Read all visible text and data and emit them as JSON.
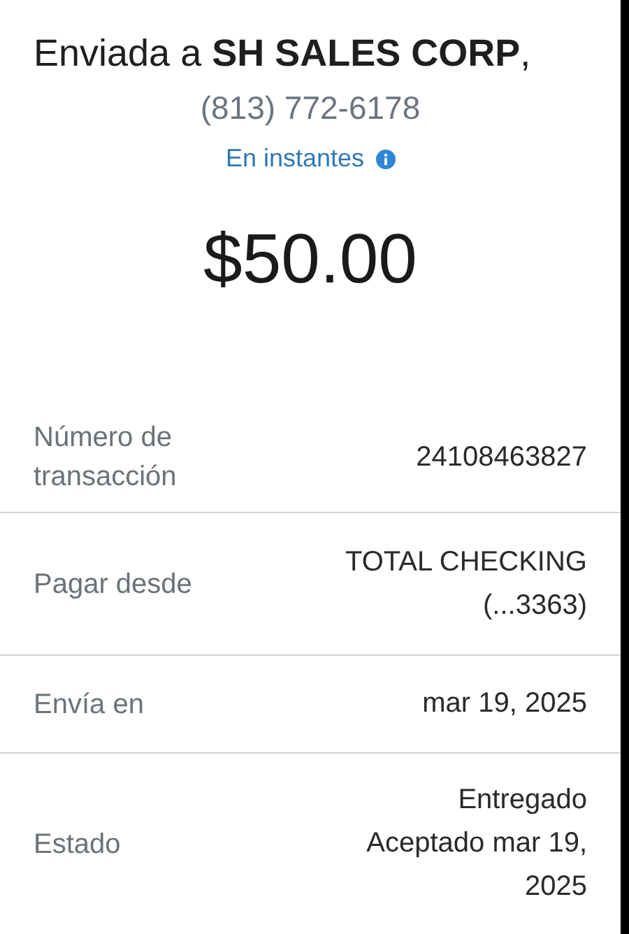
{
  "header": {
    "title": "Enviada a **SH SALES CORP**,",
    "phone": "(813) 772-6178",
    "speed": "En instantes",
    "amount": "$50.00"
  },
  "details": [
    {
      "label": "Número de transacción",
      "value": [
        "24108463827"
      ]
    },
    {
      "label": "Pagar desde",
      "value": [
        "TOTAL CHECKING",
        "(...3363)"
      ]
    },
    {
      "label": "Envía en",
      "value": [
        "mar 19, 2025"
      ]
    },
    {
      "label": "Estado",
      "value": [
        "Entregado",
        "Aceptado mar 19,",
        "2025"
      ]
    }
  ]
}
